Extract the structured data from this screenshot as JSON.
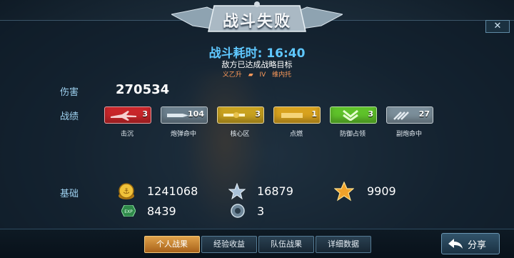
{
  "header": {
    "title": "战斗失败",
    "close_label": "✕"
  },
  "battle": {
    "time": "战斗耗时: 16:40",
    "reason": "敌方已达成战略目标",
    "ship_name": "义乙升",
    "ship_tier": "IV",
    "ship_name2": "维内托"
  },
  "damage": {
    "label": "伤害",
    "value": "270534"
  },
  "achievements": {
    "label": "战绩",
    "items": [
      {
        "name": "击沉",
        "count": "3",
        "color": "#c9262a",
        "icon": "plane-icon"
      },
      {
        "name": "炮弹命中",
        "count": "104",
        "color": "#6b7f8d",
        "icon": "shell-icon"
      },
      {
        "name": "核心区",
        "count": "3",
        "color": "#c9a21f",
        "icon": "core-gun-icon"
      },
      {
        "name": "点燃",
        "count": "1",
        "color": "#d8a21e",
        "icon": "fire-icon"
      },
      {
        "name": "防御占领",
        "count": "3",
        "color": "#5fc22a",
        "icon": "chevron-defense-icon"
      },
      {
        "name": "副炮命中",
        "count": "27",
        "color": "#7b8e9a",
        "icon": "secondary-gun-icon"
      }
    ]
  },
  "base": {
    "label": "基础",
    "coins": "1241068",
    "stars": "16879",
    "gold_star": "9909",
    "exp": "8439",
    "orbs": "3"
  },
  "tabs": [
    {
      "label": "个人战果",
      "active": true
    },
    {
      "label": "经验收益",
      "active": false
    },
    {
      "label": "队伍战果",
      "active": false
    },
    {
      "label": "详细数据",
      "active": false
    }
  ],
  "share": {
    "label": "分享"
  }
}
